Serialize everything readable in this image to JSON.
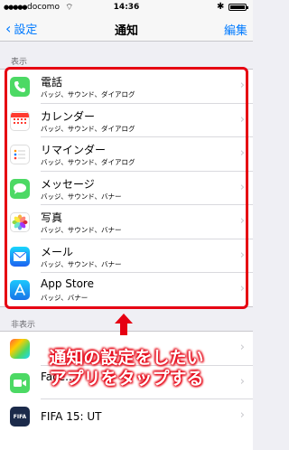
{
  "status_bar": {
    "carrier": "docomo",
    "time": "14:36"
  },
  "nav": {
    "back_label": "設定",
    "title": "通知",
    "edit_label": "編集"
  },
  "sections": {
    "shown_header": "表示",
    "hidden_header": "非表示"
  },
  "shown_apps": [
    {
      "name": "電話",
      "detail": "バッジ、サウンド、ダイアログ",
      "icon": "phone-icon",
      "color": "#4cd964"
    },
    {
      "name": "カレンダー",
      "detail": "バッジ、サウンド、ダイアログ",
      "icon": "calendar-icon",
      "color": "#ffffff"
    },
    {
      "name": "リマインダー",
      "detail": "バッジ、サウンド、ダイアログ",
      "icon": "reminders-icon",
      "color": "#ffffff"
    },
    {
      "name": "メッセージ",
      "detail": "バッジ、サウンド、バナー",
      "icon": "messages-icon",
      "color": "#4cd964"
    },
    {
      "name": "写真",
      "detail": "バッジ、サウンド、バナー",
      "icon": "photos-icon",
      "color": "#ffffff"
    },
    {
      "name": "メール",
      "detail": "バッジ、サウンド、バナー",
      "icon": "mail-icon",
      "color": "#1e90ff"
    },
    {
      "name": "App Store",
      "detail": "バッジ、バナー",
      "icon": "app-store-icon",
      "color": "#1a8cff"
    }
  ],
  "hidden_apps": [
    {
      "name": "",
      "icon": "app-icon-colorful",
      "color": "#f5a623"
    },
    {
      "name": "Face...",
      "icon": "facetime-icon",
      "color": "#4cd964"
    },
    {
      "name": "FIFA 15: UT",
      "icon": "fifa-icon",
      "color": "#1b2a4a"
    }
  ],
  "callout": {
    "line1": "通知の設定をしたい",
    "line2": "アプリをタップする"
  }
}
